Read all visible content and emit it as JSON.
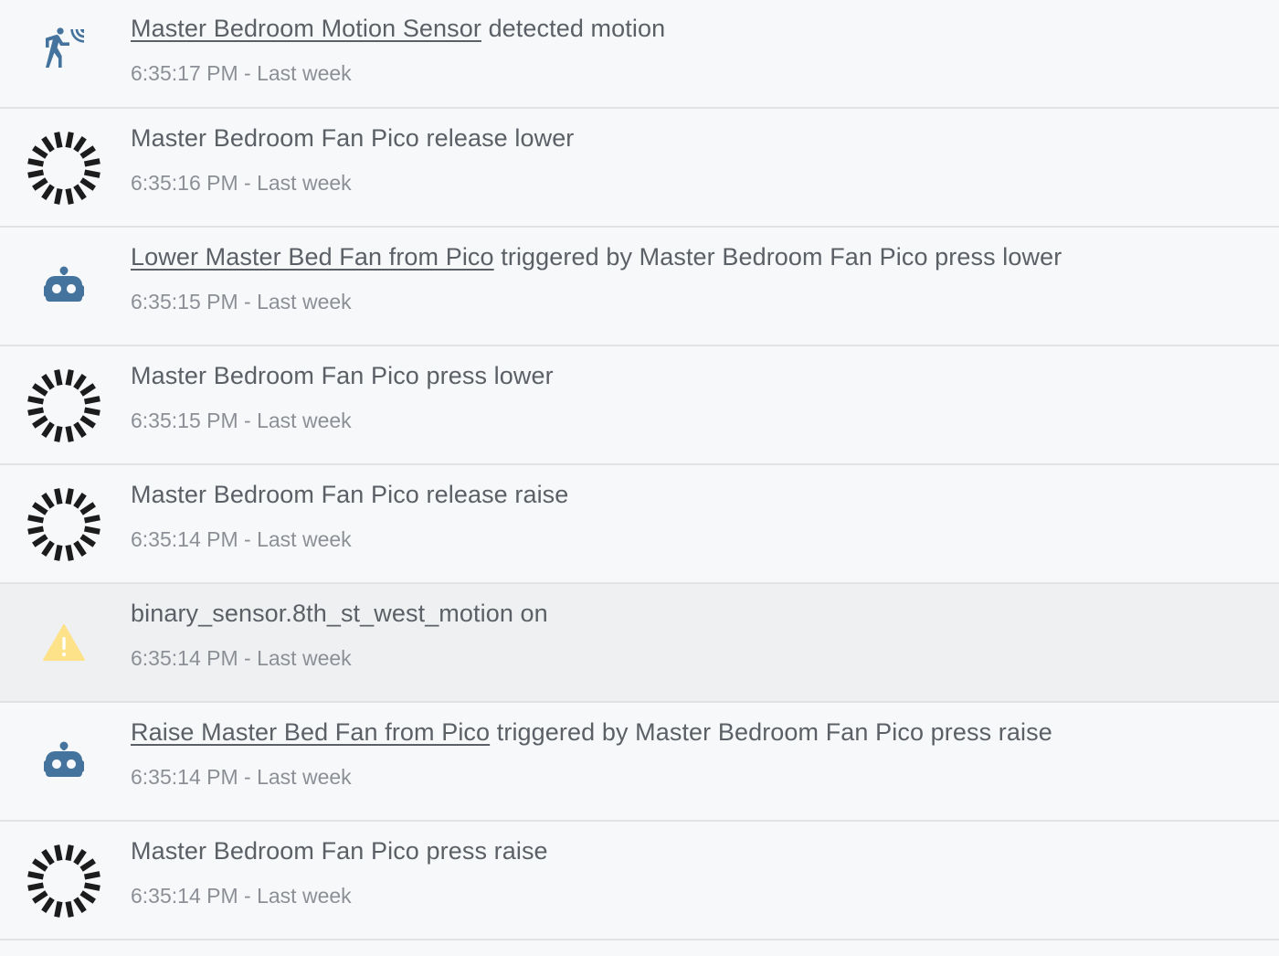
{
  "colors": {
    "background": "#f7f8fa",
    "highlight_row": "#eff0f2",
    "divider": "#e1e3e6",
    "text": "#5b6066",
    "time_text": "#8c9096",
    "icon_blue": "#44739e",
    "icon_dark": "#1c1c1c",
    "warning_yellow": "#fde28a"
  },
  "entries": [
    {
      "icon": "motion-sensor-icon",
      "link": "Master Bedroom Motion Sensor",
      "text": " detected motion",
      "time": "6:35:17 PM",
      "separator": " - ",
      "relative": "Last week"
    },
    {
      "icon": "pico-remote-icon",
      "link": "",
      "text": "Master Bedroom Fan Pico release lower",
      "time": "6:35:16 PM",
      "separator": " - ",
      "relative": "Last week"
    },
    {
      "icon": "robot-icon",
      "link": "Lower Master Bed Fan from Pico",
      "text": " triggered by Master Bedroom Fan Pico press lower",
      "time": "6:35:15 PM",
      "separator": " - ",
      "relative": "Last week"
    },
    {
      "icon": "pico-remote-icon",
      "link": "",
      "text": "Master Bedroom Fan Pico press lower",
      "time": "6:35:15 PM",
      "separator": " - ",
      "relative": "Last week"
    },
    {
      "icon": "pico-remote-icon",
      "link": "",
      "text": "Master Bedroom Fan Pico release raise",
      "time": "6:35:14 PM",
      "separator": " - ",
      "relative": "Last week"
    },
    {
      "icon": "warning-icon",
      "link": "",
      "text": "binary_sensor.8th_st_west_motion on",
      "time": "6:35:14 PM",
      "separator": " - ",
      "relative": "Last week"
    },
    {
      "icon": "robot-icon",
      "link": "Raise Master Bed Fan from Pico",
      "text": " triggered by Master Bedroom Fan Pico press raise",
      "time": "6:35:14 PM",
      "separator": " - ",
      "relative": "Last week"
    },
    {
      "icon": "pico-remote-icon",
      "link": "",
      "text": "Master Bedroom Fan Pico press raise",
      "time": "6:35:14 PM",
      "separator": " - ",
      "relative": "Last week"
    }
  ]
}
